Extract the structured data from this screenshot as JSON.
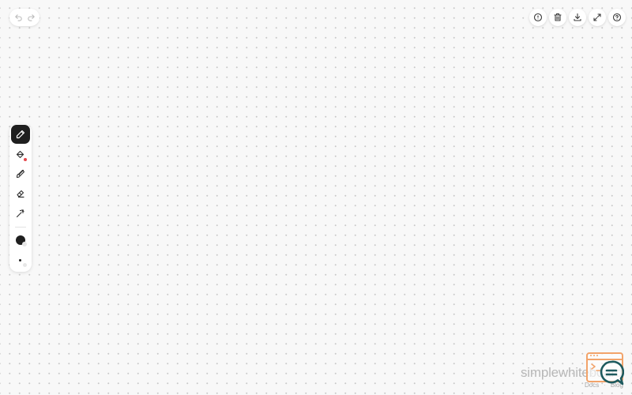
{
  "canvas": {
    "background": "#f8f8f8",
    "dot_color": "#c9c9c9"
  },
  "history": {
    "undo": {
      "icon": "undo-icon"
    },
    "redo": {
      "icon": "redo-icon"
    }
  },
  "top_actions": [
    {
      "name": "info-button",
      "icon": "info-icon"
    },
    {
      "name": "clear-button",
      "icon": "trash-icon"
    },
    {
      "name": "download-button",
      "icon": "download-icon"
    },
    {
      "name": "fullscreen-button",
      "icon": "expand-icon"
    },
    {
      "name": "help-button",
      "icon": "help-icon"
    }
  ],
  "tools": [
    {
      "name": "pen-tool",
      "icon": "pencil-icon",
      "active": true
    },
    {
      "name": "fill-tool",
      "icon": "paint-bucket-icon",
      "active": false,
      "badge_color": "#e5484d"
    },
    {
      "name": "brush-tool",
      "icon": "brush-icon",
      "active": false
    },
    {
      "name": "eraser-tool",
      "icon": "eraser-icon",
      "active": false
    },
    {
      "name": "magic-tool",
      "icon": "magic-wand-icon",
      "active": false
    }
  ],
  "current_color": "#1f1f1f",
  "brand": {
    "name": "simplewhiteboard",
    "accent": "#f2a36a",
    "chat_color": "#1e5a5e"
  },
  "footer": {
    "docs": "Docs",
    "separator": "·",
    "blog": "Blog"
  }
}
